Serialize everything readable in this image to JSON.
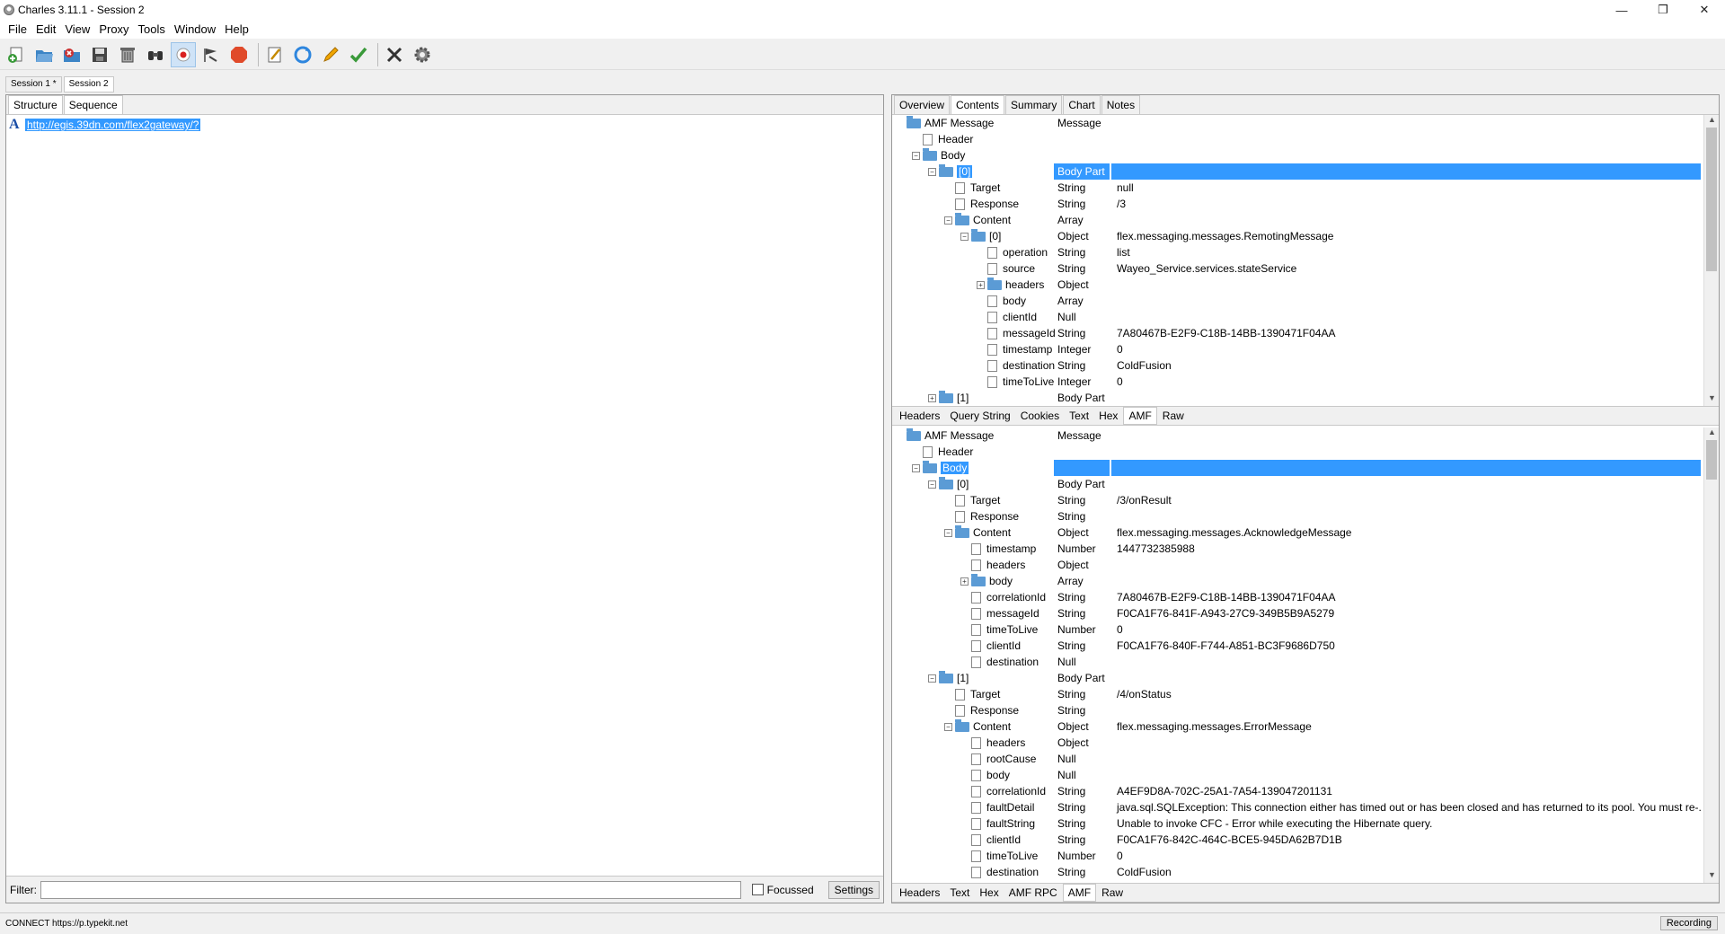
{
  "window": {
    "title": "Charles 3.11.1 - Session 2",
    "minimize": "—",
    "restore": "❐",
    "close": "✕"
  },
  "menu": [
    "File",
    "Edit",
    "View",
    "Proxy",
    "Tools",
    "Window",
    "Help"
  ],
  "toolbar_icons": [
    "new-session-icon",
    "open-session-icon",
    "close-session-icon",
    "save-icon",
    "clear-session-icon",
    "find-icon",
    "record-icon",
    "throttle-icon",
    "stop-icon",
    "edit-icon",
    "repeat-icon",
    "compose-icon",
    "validate-icon",
    "tools-icon",
    "settings-icon"
  ],
  "session_tabs": [
    {
      "label": "Session 1 *"
    },
    {
      "label": "Session 2"
    }
  ],
  "left": {
    "tabs": [
      "Structure",
      "Sequence"
    ],
    "url": "http://egis.39dn.com/flex2gateway/?",
    "filter_label": "Filter:",
    "focussed_label": "Focussed",
    "settings_label": "Settings"
  },
  "right": {
    "tabs": [
      "Overview",
      "Contents",
      "Summary",
      "Chart",
      "Notes"
    ],
    "request_subtabs": [
      "Headers",
      "Query String",
      "Cookies",
      "Text",
      "Hex",
      "AMF",
      "Raw"
    ],
    "response_subtabs": [
      "Headers",
      "Text",
      "Hex",
      "AMF RPC",
      "AMF",
      "Raw"
    ],
    "request_tree": [
      {
        "depth": 0,
        "icon": "folder",
        "exp": "",
        "name": "AMF Message",
        "type": "Message",
        "value": ""
      },
      {
        "depth": 1,
        "icon": "doc",
        "exp": "",
        "name": "Header",
        "type": "",
        "value": ""
      },
      {
        "depth": 1,
        "icon": "folder",
        "exp": "-",
        "name": "Body",
        "type": "",
        "value": ""
      },
      {
        "depth": 2,
        "icon": "folder",
        "exp": "-",
        "name": "[0]",
        "type": "Body Part",
        "value": "",
        "selected": true
      },
      {
        "depth": 3,
        "icon": "doc",
        "exp": "",
        "name": "Target",
        "type": "String",
        "value": "null"
      },
      {
        "depth": 3,
        "icon": "doc",
        "exp": "",
        "name": "Response",
        "type": "String",
        "value": "/3"
      },
      {
        "depth": 3,
        "icon": "folder",
        "exp": "-",
        "name": "Content",
        "type": "Array",
        "value": ""
      },
      {
        "depth": 4,
        "icon": "folder",
        "exp": "-",
        "name": "[0]",
        "type": "Object",
        "value": "flex.messaging.messages.RemotingMessage"
      },
      {
        "depth": 5,
        "icon": "doc",
        "exp": "",
        "name": "operation",
        "type": "String",
        "value": "list"
      },
      {
        "depth": 5,
        "icon": "doc",
        "exp": "",
        "name": "source",
        "type": "String",
        "value": "Wayeo_Service.services.stateService"
      },
      {
        "depth": 5,
        "icon": "folder",
        "exp": "+",
        "name": "headers",
        "type": "Object",
        "value": ""
      },
      {
        "depth": 5,
        "icon": "doc",
        "exp": "",
        "name": "body",
        "type": "Array",
        "value": ""
      },
      {
        "depth": 5,
        "icon": "doc",
        "exp": "",
        "name": "clientId",
        "type": "Null",
        "value": ""
      },
      {
        "depth": 5,
        "icon": "doc",
        "exp": "",
        "name": "messageId",
        "type": "String",
        "value": "7A80467B-E2F9-C18B-14BB-1390471F04AA"
      },
      {
        "depth": 5,
        "icon": "doc",
        "exp": "",
        "name": "timestamp",
        "type": "Integer",
        "value": "0"
      },
      {
        "depth": 5,
        "icon": "doc",
        "exp": "",
        "name": "destination",
        "type": "String",
        "value": "ColdFusion"
      },
      {
        "depth": 5,
        "icon": "doc",
        "exp": "",
        "name": "timeToLive",
        "type": "Integer",
        "value": "0"
      },
      {
        "depth": 2,
        "icon": "folder",
        "exp": "+",
        "name": "[1]",
        "type": "Body Part",
        "value": ""
      }
    ],
    "response_tree": [
      {
        "depth": 0,
        "icon": "folder",
        "exp": "",
        "name": "AMF Message",
        "type": "Message",
        "value": ""
      },
      {
        "depth": 1,
        "icon": "doc",
        "exp": "",
        "name": "Header",
        "type": "",
        "value": ""
      },
      {
        "depth": 1,
        "icon": "folder",
        "exp": "-",
        "name": "Body",
        "type": "",
        "value": "",
        "selected": true
      },
      {
        "depth": 2,
        "icon": "folder",
        "exp": "-",
        "name": "[0]",
        "type": "Body Part",
        "value": ""
      },
      {
        "depth": 3,
        "icon": "doc",
        "exp": "",
        "name": "Target",
        "type": "String",
        "value": "/3/onResult"
      },
      {
        "depth": 3,
        "icon": "doc",
        "exp": "",
        "name": "Response",
        "type": "String",
        "value": ""
      },
      {
        "depth": 3,
        "icon": "folder",
        "exp": "-",
        "name": "Content",
        "type": "Object",
        "value": "flex.messaging.messages.AcknowledgeMessage"
      },
      {
        "depth": 4,
        "icon": "doc",
        "exp": "",
        "name": "timestamp",
        "type": "Number",
        "value": "1447732385988"
      },
      {
        "depth": 4,
        "icon": "doc",
        "exp": "",
        "name": "headers",
        "type": "Object",
        "value": ""
      },
      {
        "depth": 4,
        "icon": "folder",
        "exp": "+",
        "name": "body",
        "type": "Array",
        "value": ""
      },
      {
        "depth": 4,
        "icon": "doc",
        "exp": "",
        "name": "correlationId",
        "type": "String",
        "value": "7A80467B-E2F9-C18B-14BB-1390471F04AA"
      },
      {
        "depth": 4,
        "icon": "doc",
        "exp": "",
        "name": "messageId",
        "type": "String",
        "value": "F0CA1F76-841F-A943-27C9-349B5B9A5279"
      },
      {
        "depth": 4,
        "icon": "doc",
        "exp": "",
        "name": "timeToLive",
        "type": "Number",
        "value": "0"
      },
      {
        "depth": 4,
        "icon": "doc",
        "exp": "",
        "name": "clientId",
        "type": "String",
        "value": "F0CA1F76-840F-F744-A851-BC3F9686D750"
      },
      {
        "depth": 4,
        "icon": "doc",
        "exp": "",
        "name": "destination",
        "type": "Null",
        "value": ""
      },
      {
        "depth": 2,
        "icon": "folder",
        "exp": "-",
        "name": "[1]",
        "type": "Body Part",
        "value": ""
      },
      {
        "depth": 3,
        "icon": "doc",
        "exp": "",
        "name": "Target",
        "type": "String",
        "value": "/4/onStatus"
      },
      {
        "depth": 3,
        "icon": "doc",
        "exp": "",
        "name": "Response",
        "type": "String",
        "value": ""
      },
      {
        "depth": 3,
        "icon": "folder",
        "exp": "-",
        "name": "Content",
        "type": "Object",
        "value": "flex.messaging.messages.ErrorMessage"
      },
      {
        "depth": 4,
        "icon": "doc",
        "exp": "",
        "name": "headers",
        "type": "Object",
        "value": ""
      },
      {
        "depth": 4,
        "icon": "doc",
        "exp": "",
        "name": "rootCause",
        "type": "Null",
        "value": ""
      },
      {
        "depth": 4,
        "icon": "doc",
        "exp": "",
        "name": "body",
        "type": "Null",
        "value": ""
      },
      {
        "depth": 4,
        "icon": "doc",
        "exp": "",
        "name": "correlationId",
        "type": "String",
        "value": "A4EF9D8A-702C-25A1-7A54-139047201131"
      },
      {
        "depth": 4,
        "icon": "doc",
        "exp": "",
        "name": "faultDetail",
        "type": "String",
        "value": "java.sql.SQLException: This connection either has timed out or has been closed and has returned to its pool. You must re-..."
      },
      {
        "depth": 4,
        "icon": "doc",
        "exp": "",
        "name": "faultString",
        "type": "String",
        "value": "Unable to invoke CFC - Error while executing the Hibernate query."
      },
      {
        "depth": 4,
        "icon": "doc",
        "exp": "",
        "name": "clientId",
        "type": "String",
        "value": "F0CA1F76-842C-464C-BCE5-945DA62B7D1B"
      },
      {
        "depth": 4,
        "icon": "doc",
        "exp": "",
        "name": "timeToLive",
        "type": "Number",
        "value": "0"
      },
      {
        "depth": 4,
        "icon": "doc",
        "exp": "",
        "name": "destination",
        "type": "String",
        "value": "ColdFusion"
      }
    ]
  },
  "status": {
    "text": "CONNECT https://p.typekit.net",
    "recording": "Recording"
  }
}
